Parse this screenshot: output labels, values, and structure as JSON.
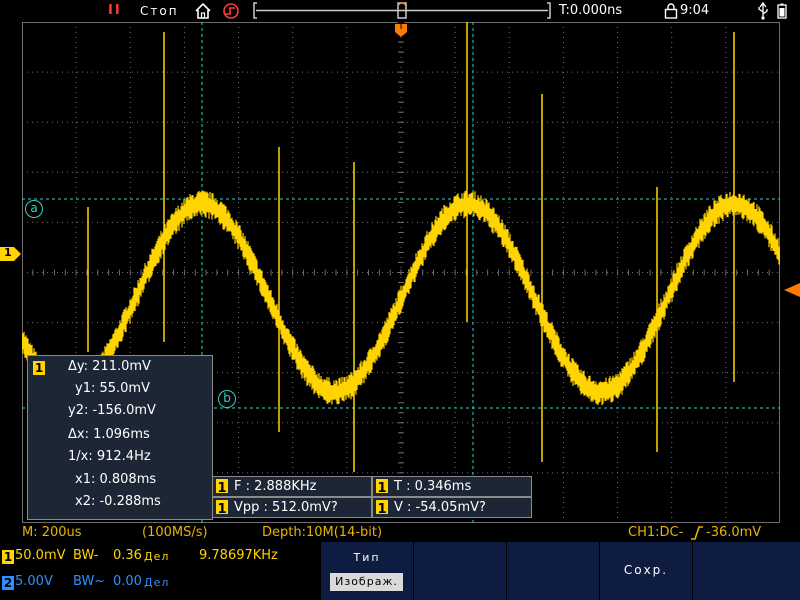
{
  "colors": {
    "ch1": "#ffd400",
    "ch2": "#2f8fff",
    "grid": "#6d6d6d",
    "cursor": "#2fd2c8",
    "trigger": "#ff7a00",
    "panel": "#1d2635",
    "softkey": "#0d1c40"
  },
  "status": {
    "run_label": "Стоп",
    "trigger_time": "T:0.000ns",
    "clock": "9:04"
  },
  "markers": {
    "ch1_marker": "1",
    "cursor_a": "a",
    "cursor_b": "b",
    "trigger_pos": "T"
  },
  "cursor_panel": {
    "channel": "1",
    "dy": "Δy: 211.0mV",
    "y1": "y1: 55.0mV",
    "y2": "y2: -156.0mV",
    "dx": "Δx: 1.096ms",
    "inv_x": "1/x: 912.4Hz",
    "x1": "x1: 0.808ms",
    "x2": "x2: -0.288ms"
  },
  "measurements": {
    "freq": {
      "channel": "1",
      "text": "F : 2.888KHz"
    },
    "period": {
      "channel": "1",
      "text": "T : 0.346ms"
    },
    "vpp": {
      "channel": "1",
      "text": "Vpp : 512.0mV?"
    },
    "vavg": {
      "channel": "1",
      "text": "V : -54.05mV?"
    }
  },
  "info_bar": {
    "timebase": "M: 200us",
    "sample_rate": "(100MS/s)",
    "depth": "Depth:10M(14-bit)",
    "trigger": "CH1:DC-",
    "trigger_level": "-36.0mV"
  },
  "channels": [
    {
      "id": "1",
      "scale": "50.0mV",
      "bw": "BW-",
      "offset": "0.36",
      "unit": "Дел",
      "freq": "9.78697KHz"
    },
    {
      "id": "2",
      "scale": "5.00V",
      "bw": "BW~",
      "offset": "0.00",
      "unit": "Дел"
    }
  ],
  "softkeys": {
    "type_label": "Тип",
    "display_label": "Изображ.",
    "save_label": "Сохр."
  }
}
